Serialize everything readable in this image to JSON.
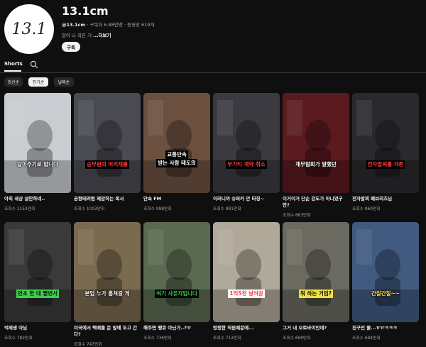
{
  "channel": {
    "avatar_text": "13.1",
    "name": "13.1cm",
    "handle": "@13.1cm",
    "meta": "· 구독자 6.88만명 · 동영상 619개",
    "description": "알아 나 작은 거",
    "more_label": "...더보기",
    "subscribe_label": "구독"
  },
  "tabs": {
    "shorts_label": "Shorts"
  },
  "chips": [
    {
      "label": "최신순",
      "active": false
    },
    {
      "label": "인기순",
      "active": true
    },
    {
      "label": "날짜순",
      "active": false
    }
  ],
  "videos": [
    {
      "title": "아직 세상 살만하네..",
      "views": "조회수 1153만회",
      "caption": "답이주기로 합니다",
      "caption_color": "#ffffff",
      "caption_bg": "",
      "bg": "#c9ccd0"
    },
    {
      "title": "공항테러범 제압하는 복서",
      "views": "조회수 1003만회",
      "caption": "승무원의 머리채를",
      "caption_color": "#ff3b3b",
      "caption_bg": "#000000",
      "bg": "#4a4a52"
    },
    {
      "title": "단속 FM",
      "views": "조회수 998만회",
      "caption": "교통단속\n받는 사람 태도의",
      "caption_color": "#ffffff",
      "caption_bg": "#000000",
      "bg": "#6b5040"
    },
    {
      "title": "이러니까 슈퍼카 안 타징~",
      "views": "조회수 881만회",
      "caption": "부가티 계약 취소",
      "caption_color": "#ff3b3b",
      "caption_bg": "#000000",
      "bg": "#3a3a40"
    },
    {
      "title": "이거이거 단순 강도가 아니었구만?",
      "views": "조회수 863만회",
      "caption": "채무협회가 말했던",
      "caption_color": "#ffffff",
      "caption_bg": "",
      "bg": "#5a1a20"
    },
    {
      "title": "전자발찌 페브리즈님",
      "views": "조회수 860만회",
      "caption": "전자발찌를 자른",
      "caption_color": "#ff3b3b",
      "caption_bg": "#000000",
      "bg": "#2a2a2e"
    },
    {
      "title": "억제생 아님",
      "views": "조회수 782만회",
      "caption": "연초 한 대 빨면서",
      "caption_color": "#111111",
      "caption_bg": "#3bd24a",
      "bg": "#3a3a3a"
    },
    {
      "title": "미국에서 택배를 문 앞에 두고 간다?",
      "views": "조회수 747만회",
      "caption": "본업 누가 훔쳐갈 게",
      "caption_color": "#ffffff",
      "caption_bg": "",
      "bg": "#7a6a50"
    },
    {
      "title": "해주면 땡큐 아닌가..?ㅠ",
      "views": "조회수 736만회",
      "caption": "여기 사유지입니다",
      "caption_color": "#3bd24a",
      "caption_bg": "#000000",
      "bg": "#5a6a50"
    },
    {
      "title": "멍청한 직원때문에...",
      "views": "조회수 712만회",
      "caption": "1억5천 날려갈",
      "caption_color": "#ff3b3b",
      "caption_bg": "#ffffff",
      "bg": "#b0a898"
    },
    {
      "title": "그거 내 오토바이인데?",
      "views": "조회수 699만회",
      "caption": "뭐 하는 거임?",
      "caption_color": "#111111",
      "caption_bg": "#f0e040",
      "bg": "#6a6a60"
    },
    {
      "title": "친구인 줄...ㅠㅠㅋㅋㅋ",
      "views": "조회수 694만회",
      "caption": "간질간질~~",
      "caption_color": "#ffee44",
      "caption_bg": "",
      "bg": "#405a80"
    }
  ]
}
